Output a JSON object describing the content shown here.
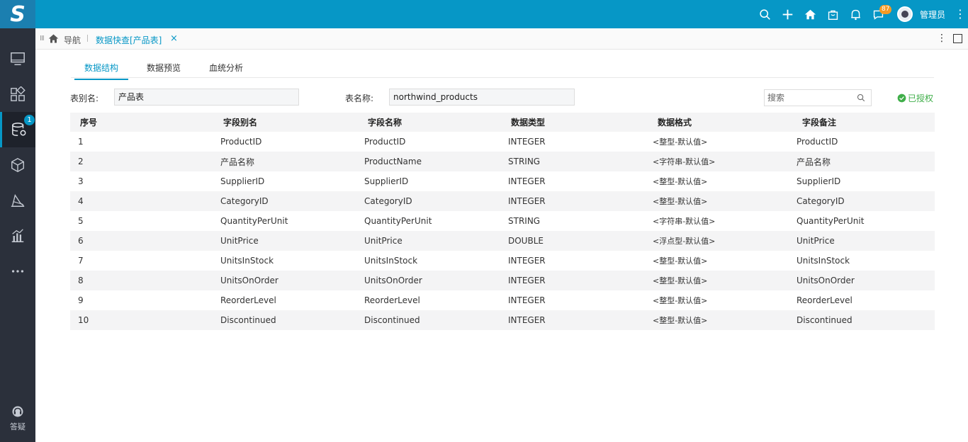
{
  "logo": {
    "letter": "S"
  },
  "header": {
    "user_name": "管理员",
    "notification_count": "87",
    "colors": {
      "topbar": "#0697c6",
      "sidebar": "#2b303b",
      "accent": "#0697c6",
      "success": "#3fae49"
    }
  },
  "sidebar": {
    "items": [
      {
        "icon": "monitor-icon"
      },
      {
        "icon": "apps-grid-icon"
      },
      {
        "icon": "database-settings-icon",
        "badge": "1",
        "active": true
      },
      {
        "icon": "cube-icon"
      },
      {
        "icon": "layers-chart-icon"
      },
      {
        "icon": "bar-chart-icon"
      },
      {
        "icon": "more-dots-icon"
      }
    ],
    "help_label": "答疑"
  },
  "tabbar": {
    "nav_label": "导航",
    "active_tab": "数据快查[产品表]",
    "close_symbol": "×"
  },
  "subtabs": [
    {
      "label": "数据结构",
      "active": true
    },
    {
      "label": "数据预览",
      "active": false
    },
    {
      "label": "血统分析",
      "active": false
    }
  ],
  "form": {
    "alias_label": "表别名:",
    "alias_value": "产品表",
    "name_label": "表名称:",
    "name_value": "northwind_products",
    "search_placeholder": "搜索",
    "authorized_label": "已授权"
  },
  "table": {
    "columns": [
      "序号",
      "字段别名",
      "字段名称",
      "数据类型",
      "数据格式",
      "字段备注"
    ],
    "rows": [
      [
        "1",
        "ProductID",
        "ProductID",
        "INTEGER",
        "<整型-默认值>",
        "ProductID"
      ],
      [
        "2",
        "产品名称",
        "ProductName",
        "STRING",
        "<字符串-默认值>",
        "产品名称"
      ],
      [
        "3",
        "SupplierID",
        "SupplierID",
        "INTEGER",
        "<整型-默认值>",
        "SupplierID"
      ],
      [
        "4",
        "CategoryID",
        "CategoryID",
        "INTEGER",
        "<整型-默认值>",
        "CategoryID"
      ],
      [
        "5",
        "QuantityPerUnit",
        "QuantityPerUnit",
        "STRING",
        "<字符串-默认值>",
        "QuantityPerUnit"
      ],
      [
        "6",
        "UnitPrice",
        "UnitPrice",
        "DOUBLE",
        "<浮点型-默认值>",
        "UnitPrice"
      ],
      [
        "7",
        "UnitsInStock",
        "UnitsInStock",
        "INTEGER",
        "<整型-默认值>",
        "UnitsInStock"
      ],
      [
        "8",
        "UnitsOnOrder",
        "UnitsOnOrder",
        "INTEGER",
        "<整型-默认值>",
        "UnitsOnOrder"
      ],
      [
        "9",
        "ReorderLevel",
        "ReorderLevel",
        "INTEGER",
        "<整型-默认值>",
        "ReorderLevel"
      ],
      [
        "10",
        "Discontinued",
        "Discontinued",
        "INTEGER",
        "<整型-默认值>",
        "Discontinued"
      ]
    ]
  }
}
